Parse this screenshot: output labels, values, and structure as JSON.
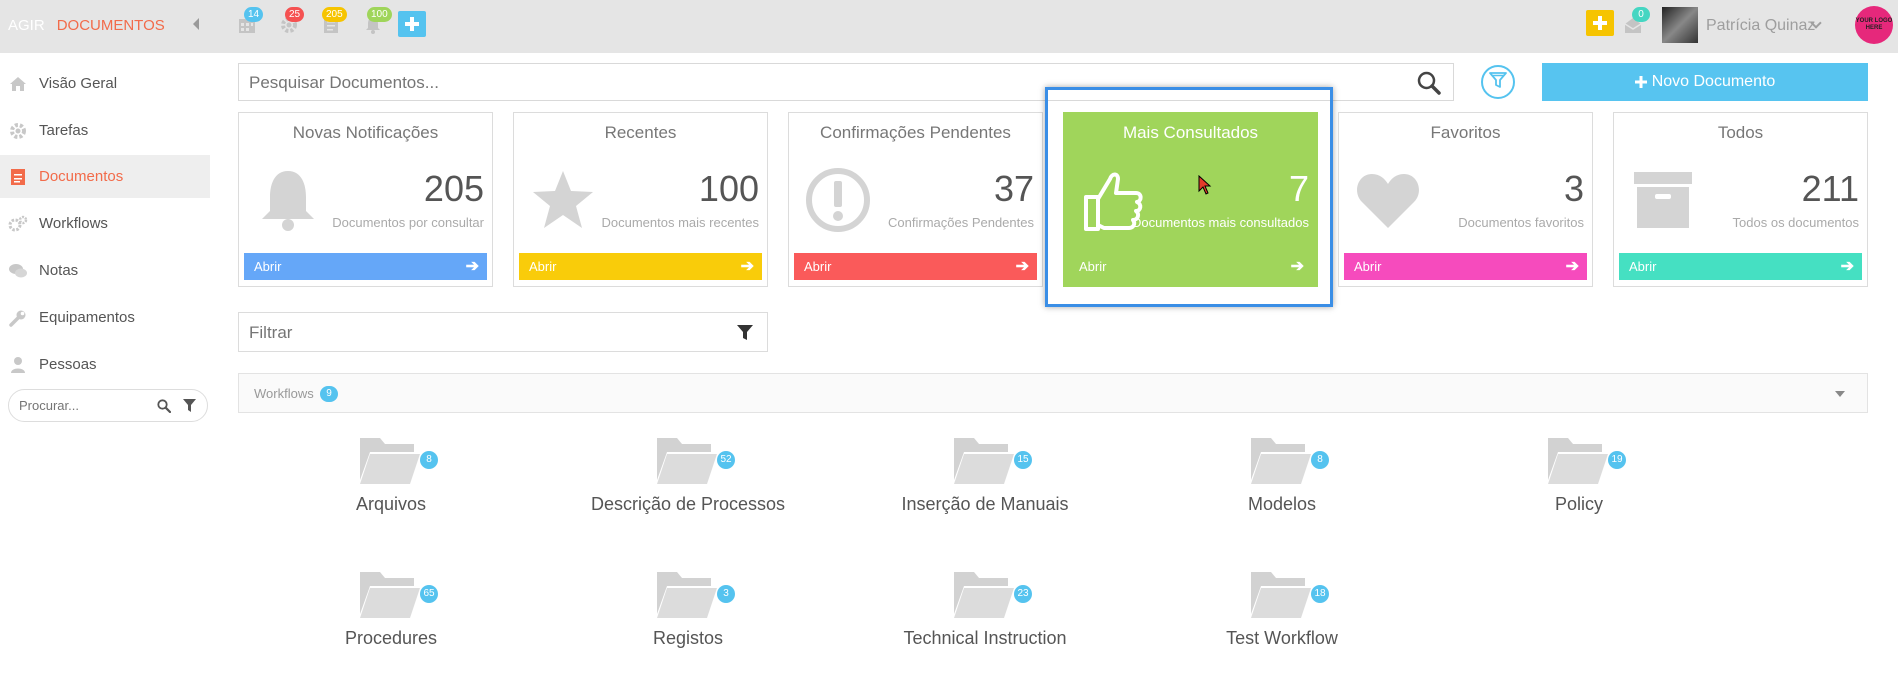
{
  "header": {
    "brand_prefix": "AGIR",
    "brand_module": "DOCUMENTOS",
    "badges": {
      "calendar": "14",
      "settings": "25",
      "documents": "205",
      "notifications": "100",
      "inbox": "0"
    },
    "user_name": "Patrícia Quinaz",
    "logo_text": "YOUR LOGO HERE",
    "colors": {
      "calendar": "#55c3ef",
      "settings": "#f55252",
      "documents": "#f6c400",
      "notifications": "#9fd55a"
    }
  },
  "sidebar": {
    "items": [
      {
        "label": "Visão Geral",
        "icon": "home-icon"
      },
      {
        "label": "Tarefas",
        "icon": "gear-icon"
      },
      {
        "label": "Documentos",
        "icon": "document-icon"
      },
      {
        "label": "Workflows",
        "icon": "cogs-icon"
      },
      {
        "label": "Notas",
        "icon": "comments-icon"
      },
      {
        "label": "Equipamentos",
        "icon": "wrench-icon"
      },
      {
        "label": "Pessoas",
        "icon": "user-icon"
      }
    ],
    "search_placeholder": "Procurar..."
  },
  "main": {
    "search_placeholder": "Pesquisar Documentos...",
    "new_document_label": "Novo Documento",
    "cards": [
      {
        "title": "Novas Notificações",
        "count": "205",
        "subtitle": "Documentos por consultar",
        "button": "Abrir",
        "color": "#65a7f8",
        "icon": "bell-icon"
      },
      {
        "title": "Recentes",
        "count": "100",
        "subtitle": "Documentos mais recentes",
        "button": "Abrir",
        "color": "#f9cc0a",
        "icon": "star-icon"
      },
      {
        "title": "Confirmações Pendentes",
        "count": "37",
        "subtitle": "Confirmações Pendentes",
        "button": "Abrir",
        "color": "#fa5a5a",
        "icon": "exclamation-circle-icon"
      },
      {
        "title": "Mais Consultados",
        "count": "7",
        "subtitle": "Documentos mais consultados",
        "button": "Abrir",
        "color": "#a0d55b",
        "icon": "thumbs-up-icon"
      },
      {
        "title": "Favoritos",
        "count": "3",
        "subtitle": "Documentos favoritos",
        "button": "Abrir",
        "color": "#f64bbd",
        "icon": "heart-icon"
      },
      {
        "title": "Todos",
        "count": "211",
        "subtitle": "Todos os documentos",
        "button": "Abrir",
        "color": "#45e0c2",
        "icon": "archive-icon"
      }
    ],
    "filter_placeholder": "Filtrar",
    "workflows_label": "Workflows",
    "workflows_count": "9",
    "folders": [
      {
        "name": "Arquivos",
        "count": "8"
      },
      {
        "name": "Descrição de Processos",
        "count": "52"
      },
      {
        "name": "Inserção de Manuais",
        "count": "15"
      },
      {
        "name": "Modelos",
        "count": "8"
      },
      {
        "name": "Policy",
        "count": "19"
      },
      {
        "name": "Procedures",
        "count": "65"
      },
      {
        "name": "Registos",
        "count": "3"
      },
      {
        "name": "Technical Instruction",
        "count": "23"
      },
      {
        "name": "Test Workflow",
        "count": "18"
      }
    ]
  }
}
